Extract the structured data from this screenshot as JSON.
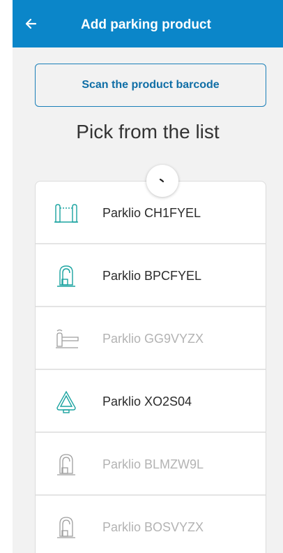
{
  "appbar": {
    "title": "Add parking product"
  },
  "scan_button": {
    "label": "Scan the product barcode"
  },
  "pick_title": "Pick from the list",
  "colors": {
    "primary": "#0b86c9",
    "accent_teal": "#1aa3a0",
    "disabled_text": "#b3b3b3"
  },
  "products": [
    {
      "label": "Parklio CH1FYEL",
      "icon": "gate-icon",
      "enabled": true
    },
    {
      "label": "Parklio BPCFYEL",
      "icon": "barrier-icon",
      "enabled": true
    },
    {
      "label": "Parklio GG9VYZX",
      "icon": "arm-barrier-icon",
      "enabled": false
    },
    {
      "label": "Parklio XO2S04",
      "icon": "bollard-icon",
      "enabled": true
    },
    {
      "label": "Parklio BLMZW9L",
      "icon": "barrier-icon",
      "enabled": false
    },
    {
      "label": "Parklio BOSVYZX",
      "icon": "barrier-icon",
      "enabled": false
    }
  ]
}
